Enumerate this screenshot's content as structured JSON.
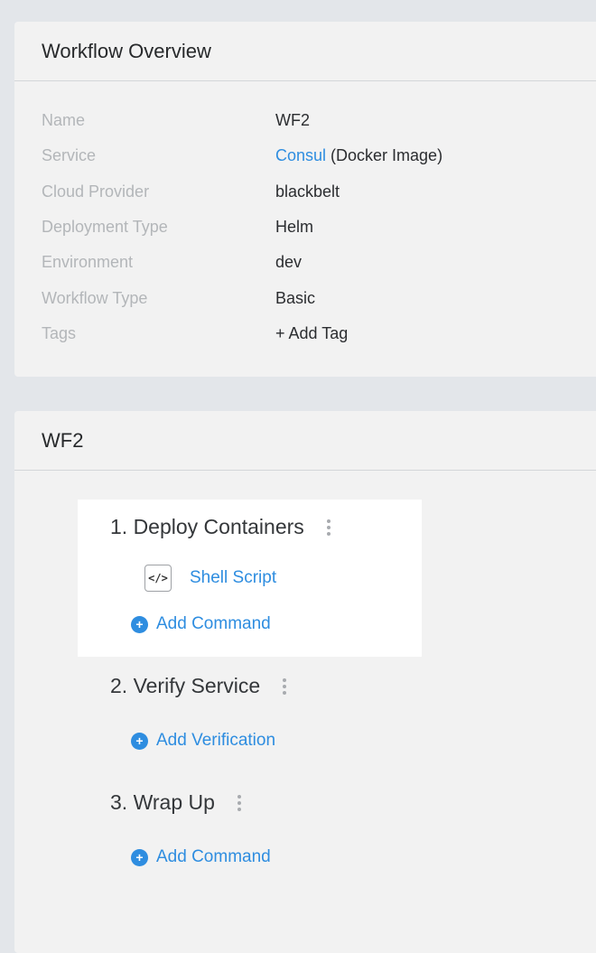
{
  "overview": {
    "title": "Workflow Overview",
    "rows": [
      {
        "label": "Name",
        "value": "WF2"
      },
      {
        "label": "Service",
        "link": "Consul",
        "suffix": " (Docker Image)"
      },
      {
        "label": "Cloud Provider",
        "link": "blackbelt"
      },
      {
        "label": "Deployment Type",
        "value": "Helm"
      },
      {
        "label": "Environment",
        "link": "dev"
      },
      {
        "label": "Workflow Type",
        "value": "Basic"
      },
      {
        "label": "Tags",
        "link": "+ Add Tag"
      }
    ]
  },
  "workflow": {
    "title": "WF2",
    "steps": [
      {
        "title": "1. Deploy Containers",
        "command": "Shell Script",
        "add_label": "Add Command"
      },
      {
        "title": "2. Verify Service",
        "add_label": "Add Verification"
      },
      {
        "title": "3. Wrap Up",
        "add_label": "Add Command"
      }
    ]
  },
  "icons": {
    "code": "code-icon",
    "plus": "plus-circle-icon",
    "kebab": "kebab-menu-icon"
  },
  "colors": {
    "background": "#e3e6ea",
    "card": "#f2f2f2",
    "link": "#2e8de0",
    "label": "#b3b6b9",
    "text": "#2b2d30"
  }
}
